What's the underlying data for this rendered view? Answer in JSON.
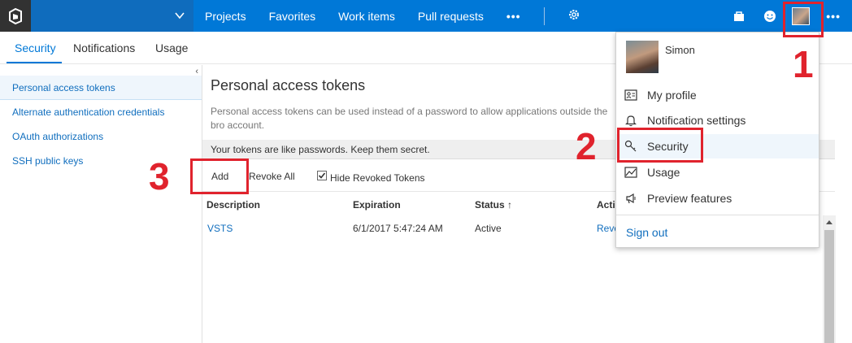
{
  "topnav": {
    "links": [
      "Projects",
      "Favorites",
      "Work items",
      "Pull requests"
    ],
    "more": "•••",
    "right_more": "•••"
  },
  "subtabs": [
    "Security",
    "Notifications",
    "Usage"
  ],
  "sidebar": {
    "items": [
      {
        "label": "Personal access tokens"
      },
      {
        "label": "Alternate authentication credentials"
      },
      {
        "label": "OAuth authorizations"
      },
      {
        "label": "SSH public keys"
      }
    ]
  },
  "main": {
    "title": "Personal access tokens",
    "description": "Personal access tokens can be used instead of a password to allow applications outside the bro account.",
    "warning": "Your tokens are like passwords. Keep them secret.",
    "toolbar": {
      "add_label": "Add",
      "revoke_all_label": "Revoke All",
      "hide_revoked_label": "Hide Revoked Tokens",
      "hide_revoked_checked": true
    },
    "table": {
      "headers": [
        "Description",
        "Expiration",
        "Status ↑",
        "Actio"
      ],
      "rows": [
        {
          "description": "VSTS",
          "expiration": "6/1/2017 5:47:24 AM",
          "status": "Active",
          "action": "Revo"
        }
      ]
    }
  },
  "user_menu": {
    "name": "Simon",
    "items": [
      {
        "label": "My profile",
        "icon": "contact-card-icon"
      },
      {
        "label": "Notification settings",
        "icon": "bell-icon"
      },
      {
        "label": "Security",
        "icon": "key-icon"
      },
      {
        "label": "Usage",
        "icon": "chart-icon"
      },
      {
        "label": "Preview features",
        "icon": "megaphone-icon"
      }
    ],
    "sign_out": "Sign out"
  },
  "annotations": {
    "one": "1",
    "two": "2",
    "three": "3",
    "color": "#e0232d"
  },
  "colors": {
    "accent": "#0078d7",
    "topbar": "#0078d7"
  }
}
